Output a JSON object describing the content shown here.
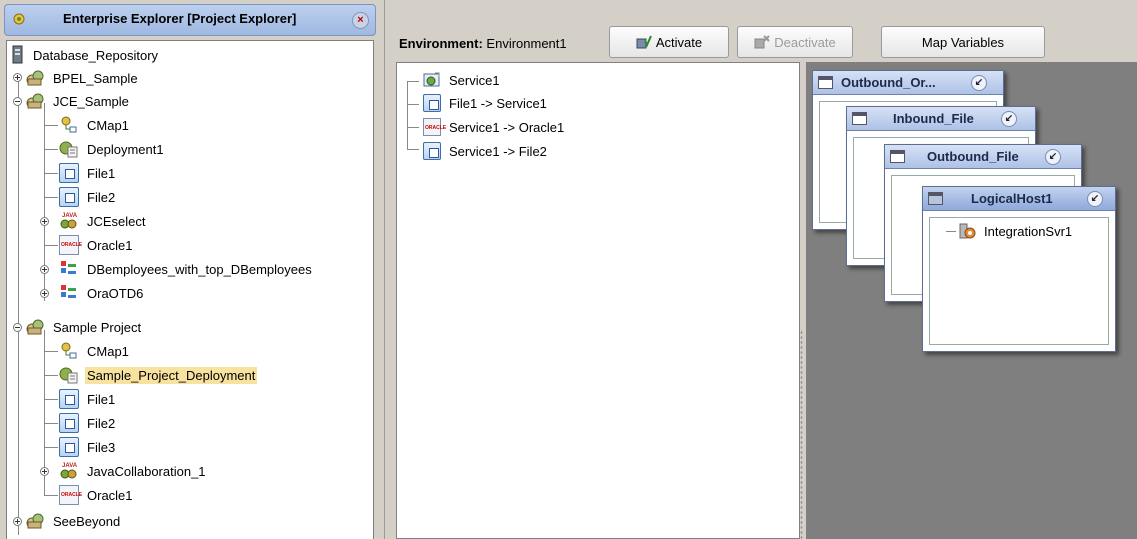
{
  "explorer": {
    "title": "Enterprise Explorer [Project Explorer]",
    "close_label": "×",
    "tree": [
      {
        "label": "Database_Repository",
        "icon": "repository-icon"
      },
      {
        "label": "BPEL_Sample",
        "icon": "project-icon"
      },
      {
        "label": "JCE_Sample",
        "icon": "project-icon"
      },
      {
        "label": "CMap1",
        "icon": "connectivity-map-icon"
      },
      {
        "label": "Deployment1",
        "icon": "deployment-icon"
      },
      {
        "label": "File1",
        "icon": "file-icon"
      },
      {
        "label": "File2",
        "icon": "file-icon"
      },
      {
        "label": "JCEselect",
        "icon": "java-collaboration-icon"
      },
      {
        "label": "Oracle1",
        "icon": "oracle-icon"
      },
      {
        "label": "DBemployees_with_top_DBemployees",
        "icon": "otd-icon"
      },
      {
        "label": "OraOTD6",
        "icon": "otd-icon"
      },
      {
        "label": "Sample Project",
        "icon": "project-icon"
      },
      {
        "label": "CMap1",
        "icon": "connectivity-map-icon"
      },
      {
        "label": "Sample_Project_Deployment",
        "icon": "deployment-icon"
      },
      {
        "label": "File1",
        "icon": "file-icon"
      },
      {
        "label": "File2",
        "icon": "file-icon"
      },
      {
        "label": "File3",
        "icon": "file-icon"
      },
      {
        "label": "JavaCollaboration_1",
        "icon": "java-collaboration-icon"
      },
      {
        "label": "Oracle1",
        "icon": "oracle-icon"
      },
      {
        "label": "SeeBeyond",
        "icon": "project-icon"
      }
    ]
  },
  "toolbar": {
    "env_prefix": "Environment:",
    "env_name": "Environment1",
    "activate_label": "Activate",
    "deactivate_label": "Deactivate",
    "map_variables_label": "Map Variables"
  },
  "services": [
    {
      "label": "Service1",
      "icon": "service-icon"
    },
    {
      "label": "File1 -> Service1",
      "icon": "file-icon"
    },
    {
      "label": "Service1 -> Oracle1",
      "icon": "oracle-icon"
    },
    {
      "label": "Service1 -> File2",
      "icon": "file-icon"
    }
  ],
  "windows": [
    {
      "title": "Outbound_Or...",
      "button": "↙"
    },
    {
      "title": "Inbound_File",
      "button": "↙"
    },
    {
      "title": "Outbound_File",
      "button": "↙"
    },
    {
      "title": "LogicalHost1",
      "button": "↙"
    }
  ],
  "logical_host": {
    "server_label": "IntegrationSvr1",
    "icon": "integration-server-icon"
  },
  "colors": {
    "selection": "#f7e39f",
    "window_title": "#aec2e6",
    "canvas_bg": "#7f7f7f"
  }
}
